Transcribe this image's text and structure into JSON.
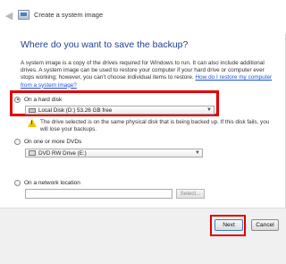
{
  "window": {
    "title": "Create a system image"
  },
  "heading": "Where do you want to save the backup?",
  "description": {
    "text": "A system image is a copy of the drives required for Windows to run. It can also include additional drives. A system image can be used to restore your computer if your hard drive or computer ever stops working; however, you can't choose individual items to restore.",
    "link": "How do I restore my computer from a system image?"
  },
  "hard_disk": {
    "label": "On a hard disk",
    "selected": true,
    "selected_value": "Local Disk (D:)  53.26 GB free",
    "warning": "The drive selected is on the same physical disk that is being backed up. If this disk fails, you will lose your backups."
  },
  "dvd": {
    "label": "On one or more DVDs",
    "selected_value": "DVD RW Drive (E:)"
  },
  "network": {
    "label": "On a network location",
    "input_value": "",
    "select_label": "Select..."
  },
  "buttons": {
    "next": "Next",
    "cancel": "Cancel"
  },
  "icons": {
    "back": "back-arrow-icon",
    "app": "system-image-icon",
    "warning": "warning-icon"
  },
  "colors": {
    "heading": "#1f3f8f",
    "highlight": "#e00000",
    "link": "#1a55d4"
  }
}
